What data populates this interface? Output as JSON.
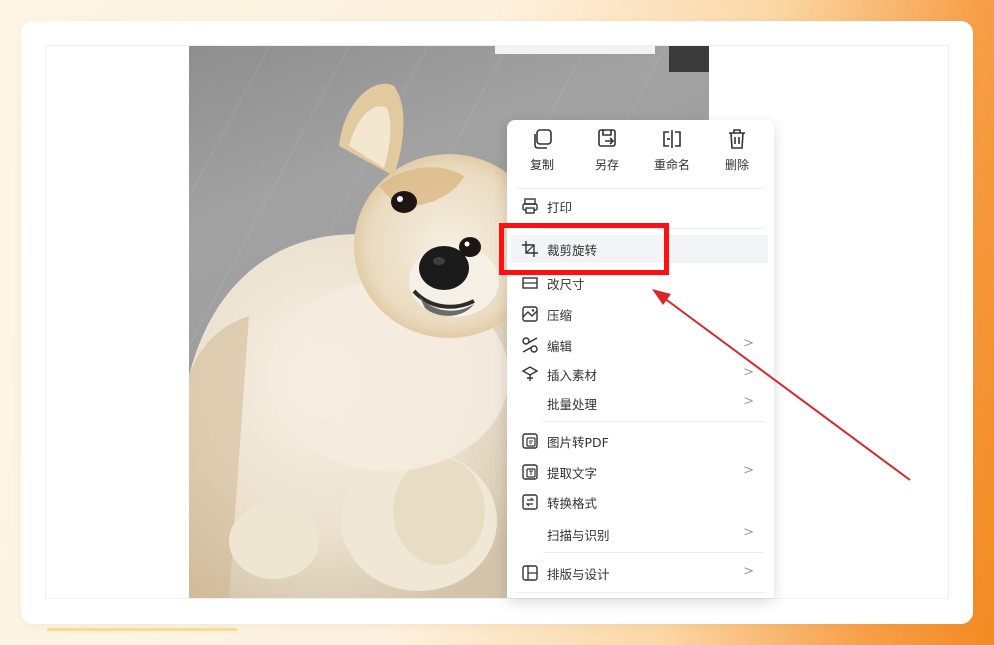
{
  "top_actions": [
    {
      "label": "复制",
      "icon": "copy-icon"
    },
    {
      "label": "另存",
      "icon": "save-as-icon"
    },
    {
      "label": "重命名",
      "icon": "rename-icon"
    },
    {
      "label": "删除",
      "icon": "trash-icon"
    }
  ],
  "menu_items": [
    {
      "label": "打印",
      "icon": "printer-icon",
      "has_submenu": false
    },
    {
      "label": "裁剪旋转",
      "icon": "crop-icon",
      "has_submenu": false,
      "highlighted": true
    },
    {
      "label": "改尺寸",
      "icon": "resize-icon",
      "has_submenu": false
    },
    {
      "label": "压缩",
      "icon": "compress-icon",
      "has_submenu": false
    },
    {
      "label": "编辑",
      "icon": "edit-icon",
      "has_submenu": true,
      "arrow": ">"
    },
    {
      "label": "插入素材",
      "icon": "insert-material-icon",
      "has_submenu": true,
      "arrow": ">"
    },
    {
      "label": "批量处理",
      "icon": "",
      "has_submenu": true,
      "arrow": ">"
    },
    {
      "label": "图片转PDF",
      "icon": "image-to-pdf-icon",
      "has_submenu": false
    },
    {
      "label": "提取文字",
      "icon": "extract-text-icon",
      "has_submenu": true,
      "arrow": ">"
    },
    {
      "label": "转换格式",
      "icon": "convert-format-icon",
      "has_submenu": false
    },
    {
      "label": "扫描与识别",
      "icon": "",
      "has_submenu": true,
      "arrow": ">"
    },
    {
      "label": "排版与设计",
      "icon": "layout-icon",
      "has_submenu": true,
      "arrow": ">"
    }
  ],
  "annotation": {
    "box_color": "#ff0f12",
    "arrow_color": "#d9262b"
  },
  "colors": {
    "background_accent": "#f38a21",
    "menu_text": "#333333"
  }
}
